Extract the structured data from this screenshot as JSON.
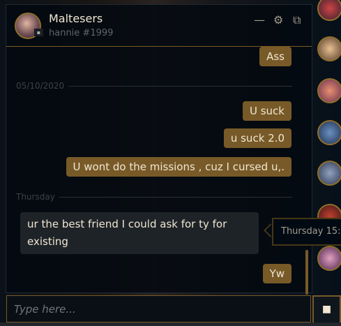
{
  "header": {
    "name": "Maltesers",
    "tag": "hannie #1999",
    "minimize_icon": "minimize-icon",
    "settings_icon": "gear-icon",
    "popout_icon": "popout-icon"
  },
  "messages": [
    {
      "type": "out",
      "text": "Ass"
    },
    {
      "type": "date",
      "text": "05/10/2020"
    },
    {
      "type": "out",
      "text": "U suck"
    },
    {
      "type": "out",
      "text": "u suck 2.0"
    },
    {
      "type": "out",
      "text": "U wont do the missions , cuz I cursed u,."
    },
    {
      "type": "date",
      "text": "Thursday"
    },
    {
      "type": "in",
      "text": "ur the best friend I could ask for ty for existing"
    },
    {
      "type": "out",
      "text": "Yw"
    }
  ],
  "tooltip": "Thursday 15:",
  "input": {
    "placeholder": "Type here..."
  },
  "colors": {
    "accent": "#785a28",
    "gold": "#8f6f2a",
    "text": "#f0e6d2"
  }
}
